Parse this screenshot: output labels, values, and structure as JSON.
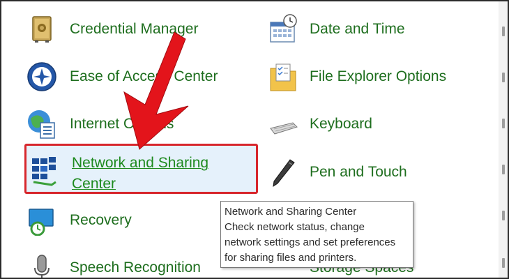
{
  "items": {
    "credential_manager": "Credential Manager",
    "date_time": "Date and Time",
    "ease_of_access": "Ease of Access Center",
    "file_explorer": "File Explorer Options",
    "internet_options": "Internet Options",
    "keyboard": "Keyboard",
    "network_sharing": "Network and Sharing\nCenter",
    "pen_touch": "Pen and Touch",
    "recovery": "Recovery",
    "speech_recognition": "Speech Recognition",
    "storage_spaces": "Storage Spaces"
  },
  "tooltip": {
    "title": "Network and Sharing Center",
    "description": "Check network status, change\nnetwork settings and set preferences\nfor sharing files and printers."
  },
  "colors": {
    "link_green": "#1e6e1e",
    "highlight_red": "#d7262c",
    "selection_bg": "#e5f1fb"
  },
  "icons": {
    "credential_manager": "safe-icon",
    "date_time": "calendar-clock-icon",
    "ease_of_access": "accessibility-icon",
    "file_explorer": "folder-options-icon",
    "internet_options": "globe-checklist-icon",
    "keyboard": "keyboard-icon",
    "network_sharing": "network-icon",
    "pen_touch": "pen-icon",
    "recovery": "recovery-monitor-icon",
    "speech_recognition": "microphone-icon",
    "storage_spaces": "storage-icon"
  }
}
